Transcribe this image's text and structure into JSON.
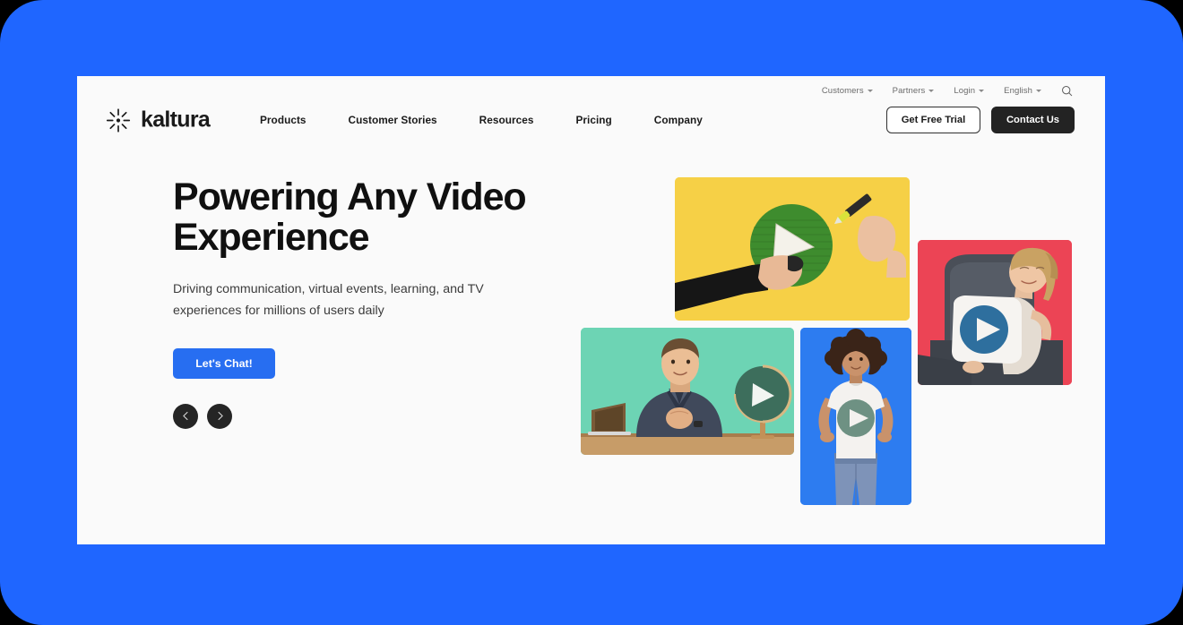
{
  "theme": {
    "page_background": "#1F66FF",
    "card_background": "#FAFAFA",
    "accent_blue": "#276EF1",
    "dark": "#232323",
    "tile_yellow": "#F6D046",
    "tile_red": "#EC4455",
    "tile_teal": "#6DD4B4",
    "tile_blue": "#2D7CF0"
  },
  "utility_nav": {
    "items": [
      {
        "label": "Customers",
        "has_caret": true
      },
      {
        "label": "Partners",
        "has_caret": true
      },
      {
        "label": "Login",
        "has_caret": true
      },
      {
        "label": "English",
        "has_caret": true
      }
    ],
    "search_icon": "search-icon"
  },
  "brand": {
    "logo_icon": "kaltura-starburst-icon",
    "name": "kaltura"
  },
  "main_nav": {
    "links": [
      {
        "label": "Products"
      },
      {
        "label": "Customer Stories"
      },
      {
        "label": "Resources"
      },
      {
        "label": "Pricing"
      },
      {
        "label": "Company"
      }
    ],
    "free_trial_label": "Get Free Trial",
    "contact_label": "Contact Us"
  },
  "hero": {
    "title": "Powering Any Video Experience",
    "subtitle": "Driving communication, virtual events, learning, and TV experiences for millions of users daily",
    "cta_label": "Let's Chat!",
    "carousel": {
      "prev_icon": "chevron-left-icon",
      "next_icon": "chevron-right-icon"
    }
  },
  "collage": {
    "tiles": [
      {
        "name": "tile-whiteboard-drawing",
        "background": "#F6D046",
        "alt": "Hands drawing a green circle with a white play triangle on a yellow wall"
      },
      {
        "name": "tile-woman-armchair",
        "background": "#EC4455",
        "alt": "Woman relaxing in a grey armchair hugging a white pillow with a blue play button"
      },
      {
        "name": "tile-presenter-desk",
        "background": "#6DD4B4",
        "alt": "Man presenting at a desk with a laptop and a green globe marked with a play triangle"
      },
      {
        "name": "tile-woman-tshirt",
        "background": "#2D7CF0",
        "alt": "Woman in a white t-shirt with a green play button standing on a blue background"
      }
    ]
  }
}
